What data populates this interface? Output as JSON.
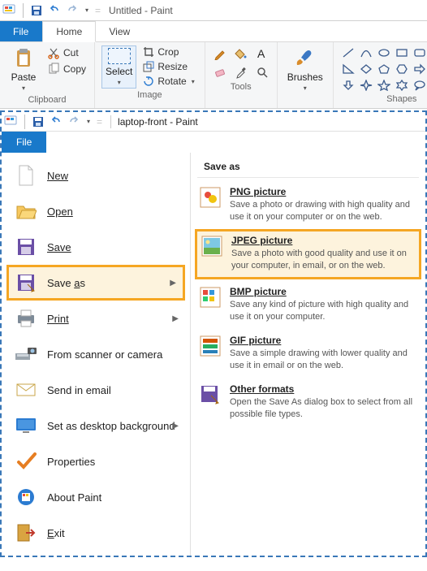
{
  "top": {
    "title": "Untitled - Paint",
    "tabs": {
      "file": "File",
      "home": "Home",
      "view": "View"
    },
    "clipboard": {
      "paste": "Paste",
      "cut": "Cut",
      "copy": "Copy",
      "group": "Clipboard"
    },
    "image": {
      "select": "Select",
      "crop": "Crop",
      "resize": "Resize",
      "rotate": "Rotate",
      "group": "Image"
    },
    "tools": {
      "group": "Tools"
    },
    "brushes": {
      "label": "Brushes"
    },
    "shapes": {
      "group": "Shapes"
    }
  },
  "sub": {
    "title": "laptop-front - Paint",
    "file": "File",
    "menu": {
      "new": "New",
      "open": "Open",
      "save": "Save",
      "saveas_pre": "Save ",
      "saveas_ul": "a",
      "saveas_post": "s",
      "print": "Print",
      "scanner": "From scanner or camera",
      "email": "Send in email",
      "desktop": "Set as desktop background",
      "properties": "Properties",
      "about": "About Paint",
      "exit_ul": "E",
      "exit_post": "xit"
    },
    "saveas": {
      "header": "Save as",
      "png": {
        "title": "PNG picture",
        "desc": "Save a photo or drawing with high quality and use it on your computer or on the web."
      },
      "jpeg": {
        "title": "JPEG picture",
        "desc": "Save a photo with good quality and use it on your computer, in email, or on the web."
      },
      "bmp": {
        "title": "BMP picture",
        "desc": "Save any kind of picture with high quality and use it on your computer."
      },
      "gif": {
        "title": "GIF picture",
        "desc": "Save a simple drawing with lower quality and use it in email or on the web."
      },
      "other": {
        "title": "Other formats",
        "desc": "Open the Save As dialog box to select from all possible file types."
      }
    }
  }
}
